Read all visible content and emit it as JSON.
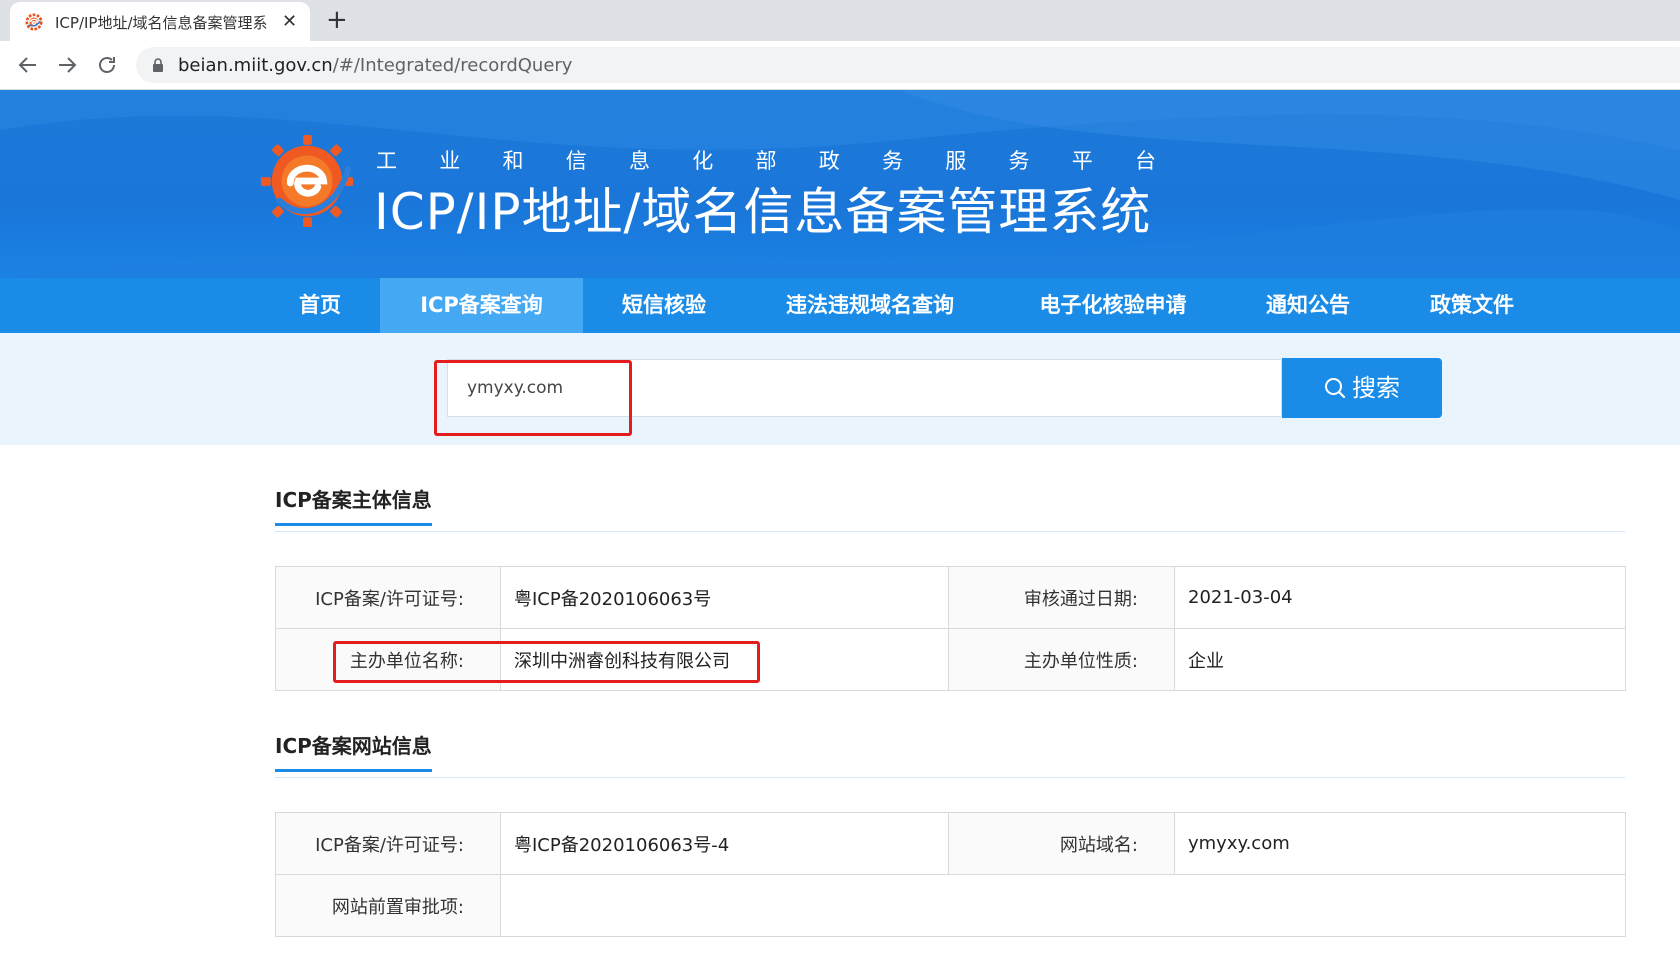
{
  "browser": {
    "tab_title": "ICP/IP地址/域名信息备案管理系",
    "url_host": "beian.miit.gov.cn",
    "url_path": "/#/Integrated/recordQuery"
  },
  "header": {
    "subtitle_chars": [
      "工",
      "业",
      "和",
      "信",
      "息",
      "化",
      "部",
      "政",
      "务",
      "服",
      "务",
      "平",
      "台"
    ],
    "title": "ICP/IP地址/域名信息备案管理系统"
  },
  "nav": {
    "items": [
      {
        "label": "首页",
        "active": false
      },
      {
        "label": "ICP备案查询",
        "active": true
      },
      {
        "label": "短信核验",
        "active": false
      },
      {
        "label": "违法违规域名查询",
        "active": false
      },
      {
        "label": "电子化核验申请",
        "active": false
      },
      {
        "label": "通知公告",
        "active": false
      },
      {
        "label": "政策文件",
        "active": false
      }
    ]
  },
  "search": {
    "value": "ymyxy.com",
    "button_label": "搜索"
  },
  "subject_section": {
    "title": "ICP备案主体信息",
    "rows": [
      {
        "label1": "ICP备案/许可证号:",
        "value1": "粤ICP备2020106063号",
        "label2": "审核通过日期:",
        "value2": "2021-03-04"
      },
      {
        "label1": "主办单位名称:",
        "value1": "深圳中洲睿创科技有限公司",
        "label2": "主办单位性质:",
        "value2": "企业"
      }
    ]
  },
  "website_section": {
    "title": "ICP备案网站信息",
    "row1": {
      "label1": "ICP备案/许可证号:",
      "value1": "粤ICP备2020106063号-4",
      "label2": "网站域名:",
      "value2": "ymyxy.com"
    },
    "row2": {
      "label1": "网站前置审批项:",
      "value1": ""
    }
  },
  "colors": {
    "header_blue": "#1a76d9",
    "nav_blue": "#1a8ce8",
    "nav_active": "#45a8f2",
    "highlight_red": "#e31c1c"
  }
}
